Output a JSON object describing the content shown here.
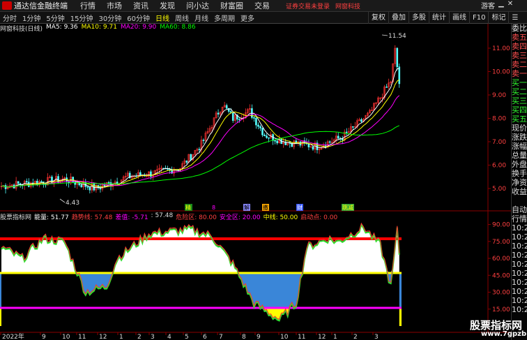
{
  "app": {
    "title": "通达信金融终端",
    "menu": [
      "行情",
      "市场",
      "资讯",
      "发现",
      "问小达",
      "财富圈",
      "交易"
    ],
    "warn": "证券交易未登录",
    "broker": "网窗科技",
    "window_controls": [
      "游客"
    ]
  },
  "toolbar": {
    "periods": [
      "分时",
      "1分钟",
      "5分钟",
      "15分钟",
      "30分钟",
      "60分钟",
      "日线",
      "周线",
      "月线",
      "多周期",
      "更多"
    ],
    "active_period": "日线",
    "right_tools": [
      "复权",
      "叠加",
      "多股",
      "统计",
      "画线",
      "F10",
      "标记",
      "☰"
    ]
  },
  "main_legend": {
    "name": "网窗科技(日线)",
    "ma5": "MA5: 9.36",
    "ma10": "MA10: 9.71",
    "ma20": "MA20: 9.90",
    "ma60": "MA60: 8.86"
  },
  "price_axis": [
    "11.00",
    "10.00",
    "9.00",
    "8.00",
    "7.00",
    "6.00",
    "5.00"
  ],
  "price_annotations": {
    "high": "11.54",
    "low": "4.43"
  },
  "signal_labels": [
    "精",
    "8",
    "解",
    "撒",
    "财",
    "跳减"
  ],
  "indicator_legend": {
    "name": "股票指标网",
    "energy": "能量: 51.77",
    "l1": "趋势线: 57.48",
    "l2": "差值: -5.71",
    "l3": ": 57.48",
    "l4": "危险区: 80.00",
    "l5": "安全区: 20.00",
    "l6": "中线: 50.00",
    "l7": "启动点: 0.00"
  },
  "ind_axis": [
    "90.00",
    "75.00",
    "60.00",
    "45.00",
    "30.00",
    "15.00"
  ],
  "time_axis": [
    "2022年",
    "9",
    "10",
    "11",
    "12",
    "1",
    "2",
    "3",
    "4",
    "5",
    "6",
    "7",
    "8",
    "9",
    "10",
    "11",
    "12",
    "1",
    "2",
    "3"
  ],
  "right_panel": [
    "委比",
    "卖五",
    "卖四",
    "卖三",
    "卖二",
    "卖一",
    "买一",
    "买二",
    "买三",
    "买四",
    "买五",
    "现价",
    "涨跌",
    "涨幅",
    "总量",
    "外盘",
    "换手",
    "净资",
    "收益",
    "",
    "自动",
    "行情",
    "10:27",
    "10:27",
    "10:27",
    "10:27",
    "10:27",
    "10:27",
    "10:27",
    "10:27",
    "10:27",
    "10:27"
  ],
  "watermark": {
    "line1": "股票指标网",
    "line2": "www.7gpzb.com"
  },
  "colors": {
    "ma5": "#ffffff",
    "ma10": "#ffff00",
    "ma20": "#ff00ff",
    "ma60": "#00ff00",
    "up": "#ff3232",
    "down": "#54ffff"
  }
}
